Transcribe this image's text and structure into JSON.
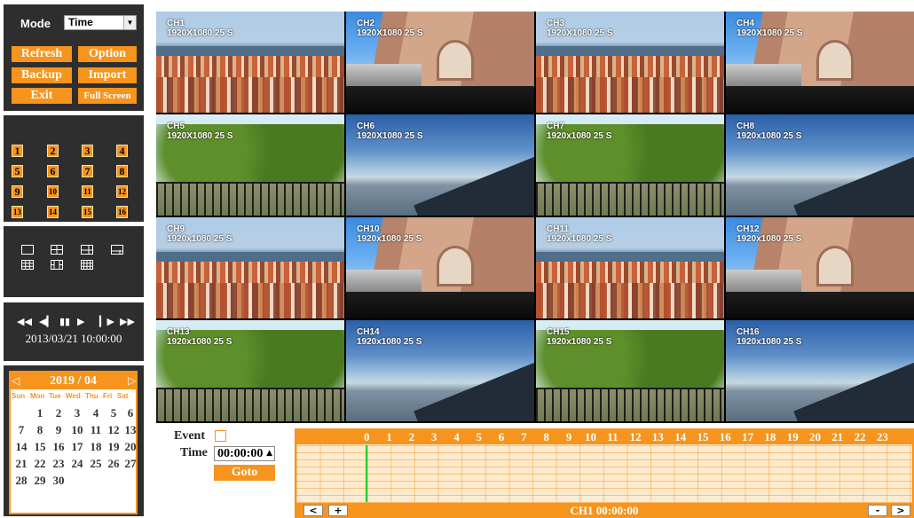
{
  "left_panel": {
    "mode_label": "Mode",
    "mode_value": "Time",
    "buttons": {
      "refresh": "Refresh",
      "option": "Option",
      "backup": "Backup",
      "import": "Import",
      "exit": "Exit",
      "full_screen": "Full Screen"
    },
    "channels": [
      "1",
      "2",
      "3",
      "4",
      "5",
      "6",
      "7",
      "8",
      "9",
      "10",
      "11",
      "12",
      "13",
      "14",
      "15",
      "16"
    ],
    "playback_time": "2013/03/21 10:00:00"
  },
  "calendar": {
    "title": "2019 / 04",
    "weekdays": [
      "Sun",
      "Mon",
      "Tue",
      "Wed",
      "Thu",
      "Fri",
      "Sat"
    ],
    "days": [
      [
        "",
        "1",
        "2",
        "3",
        "4",
        "5",
        "6"
      ],
      [
        "7",
        "8",
        "9",
        "10",
        "11",
        "12",
        "13"
      ],
      [
        "14",
        "15",
        "16",
        "17",
        "18",
        "19",
        "20"
      ],
      [
        "21",
        "22",
        "23",
        "24",
        "25",
        "26",
        "27"
      ],
      [
        "28",
        "29",
        "30",
        "",
        "",
        "",
        ""
      ]
    ]
  },
  "video": {
    "cells": [
      {
        "name": "CH1",
        "res": "1920X1080 25 S",
        "scene": "city"
      },
      {
        "name": "CH2",
        "res": "1920X1080 25 S",
        "scene": "bldg"
      },
      {
        "name": "CH3",
        "res": "1920X1080 25 S",
        "scene": "city"
      },
      {
        "name": "CH4",
        "res": "1920X1080 25 S",
        "scene": "bldg"
      },
      {
        "name": "CH5",
        "res": "1920X1080 25 S",
        "scene": "tree"
      },
      {
        "name": "CH6",
        "res": "1920X1080 25 S",
        "scene": "sky"
      },
      {
        "name": "CH7",
        "res": "1920x1080 25 S",
        "scene": "tree"
      },
      {
        "name": "CH8",
        "res": "1920x1080 25 S",
        "scene": "sky"
      },
      {
        "name": "CH9",
        "res": "1920x1080 25 S",
        "scene": "city"
      },
      {
        "name": "CH10",
        "res": "1920x1080 25 S",
        "scene": "bldg"
      },
      {
        "name": "CH11",
        "res": "1920x1080 25 S",
        "scene": "city"
      },
      {
        "name": "CH12",
        "res": "1920x1080 25 S",
        "scene": "bldg"
      },
      {
        "name": "CH13",
        "res": "1920x1080 25 S",
        "scene": "tree"
      },
      {
        "name": "CH14",
        "res": "1920x1080 25 S",
        "scene": "sky"
      },
      {
        "name": "CH15",
        "res": "1920x1080 25 S",
        "scene": "tree"
      },
      {
        "name": "CH16",
        "res": "1920x1080 25 S",
        "scene": "sky"
      }
    ]
  },
  "search": {
    "event_label": "Event",
    "time_label": "Time",
    "time_value": "00:00:00",
    "goto_label": "Goto"
  },
  "timeline": {
    "hours": [
      "0",
      "1",
      "2",
      "3",
      "4",
      "5",
      "6",
      "7",
      "8",
      "9",
      "10",
      "11",
      "12",
      "13",
      "14",
      "15",
      "16",
      "17",
      "18",
      "19",
      "20",
      "21",
      "22",
      "23"
    ],
    "status": "CH1 00:00:00",
    "prev_label": "<",
    "zoom_in_label": "+",
    "zoom_out_label": "-",
    "next_label": ">"
  }
}
